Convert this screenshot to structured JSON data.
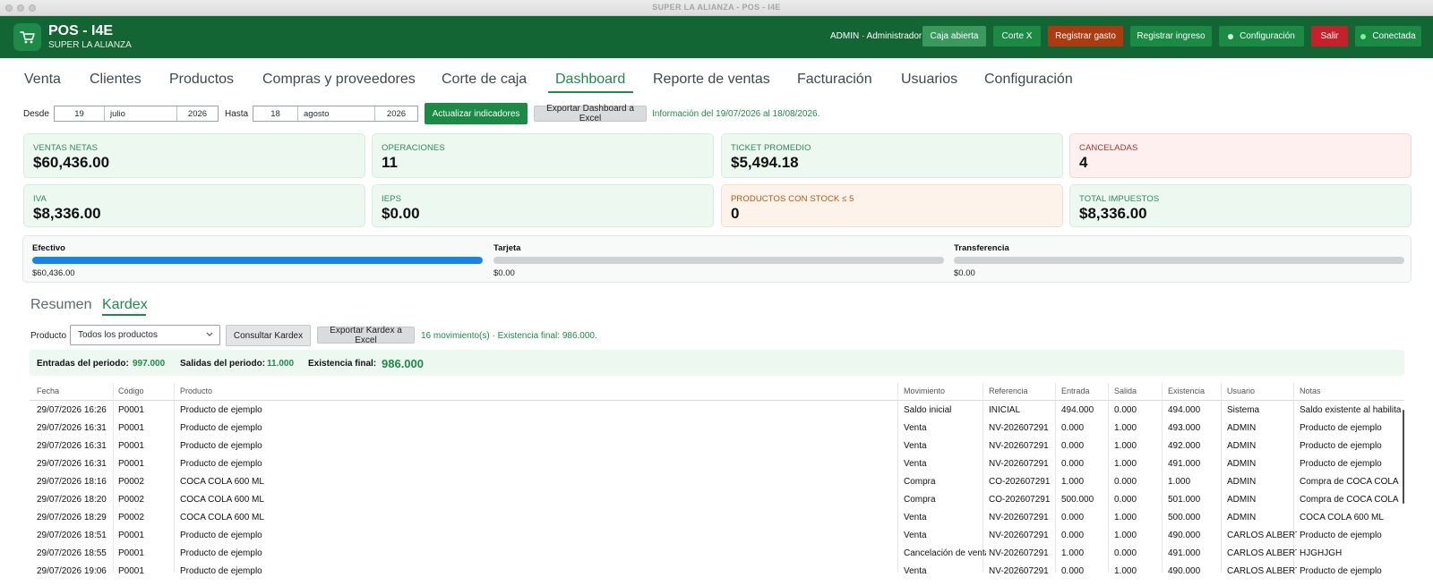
{
  "window": {
    "title": "SUPER LA ALIANZA - POS - I4E"
  },
  "header": {
    "app_name": "POS - I4E",
    "store": "SUPER LA ALIANZA",
    "user": "ADMIN · Administrador",
    "buttons": {
      "caja": "Caja abierta",
      "corte_x": "Corte X",
      "gasto": "Registrar gasto",
      "ingreso": "Registrar ingreso",
      "config": "Configuración",
      "salir": "Salir",
      "status": "Conectada"
    },
    "colors": {
      "bar": "#136634",
      "brown": "#b03a10",
      "red": "#c8202a"
    }
  },
  "tabs": [
    "Venta",
    "Clientes",
    "Productos",
    "Compras y proveedores",
    "Corte de caja",
    "Dashboard",
    "Reporte de ventas",
    "Facturación",
    "Usuarios",
    "Configuración"
  ],
  "active_tab": "Dashboard",
  "filters": {
    "desde_label": "Desde",
    "desde": {
      "day": "19",
      "month": "julio",
      "year": "2026"
    },
    "hasta_label": "Hasta",
    "hasta": {
      "day": "18",
      "month": "agosto",
      "year": "2026"
    },
    "update_button": "Actualizar indicadores",
    "export_button": "Exportar Dashboard a Excel",
    "info": "Información del 19/07/2026 al 18/08/2026."
  },
  "kpis": [
    {
      "label": "VENTAS NETAS",
      "value": "$60,436.00",
      "tone": "green"
    },
    {
      "label": "OPERACIONES",
      "value": "11",
      "tone": "green"
    },
    {
      "label": "TICKET PROMEDIO",
      "value": "$5,494.18",
      "tone": "green"
    },
    {
      "label": "CANCELADAS",
      "value": "4",
      "tone": "red"
    },
    {
      "label": "IVA",
      "value": "$8,336.00",
      "tone": "green"
    },
    {
      "label": "IEPS",
      "value": "$0.00",
      "tone": "green"
    },
    {
      "label": "PRODUCTOS CON STOCK ≤ 5",
      "value": "0",
      "tone": "orange"
    },
    {
      "label": "TOTAL IMPUESTOS",
      "value": "$8,336.00",
      "tone": "green"
    }
  ],
  "payments": [
    {
      "name": "Efectivo",
      "amount": "$60,436.00",
      "fraction": 1.0
    },
    {
      "name": "Tarjeta",
      "amount": "$0.00",
      "fraction": 0
    },
    {
      "name": "Transferencia",
      "amount": "$0.00",
      "fraction": 0
    }
  ],
  "subtabs": {
    "resumen": "Resumen",
    "kardex": "Kardex",
    "active": "Kardex"
  },
  "kardex": {
    "product_label": "Producto",
    "product_value": "Todos los productos",
    "consult_button": "Consultar Kardex",
    "export_button": "Exportar Kardex a Excel",
    "info": "16 movimiento(s) · Existencia final: 986.000.",
    "summary": {
      "entradas_label": "Entradas del periodo:",
      "entradas": "997.000",
      "salidas_label": "Salidas del periodo:",
      "salidas": "11.000",
      "existencia_label": "Existencia final:",
      "existencia": "986.000"
    },
    "columns": [
      "Fecha",
      "Código",
      "Producto",
      "Movimiento",
      "Referencia",
      "Entrada",
      "Salida",
      "Existencia",
      "Usuario",
      "Notas"
    ],
    "rows": [
      [
        "29/07/2026 16:26",
        "P0001",
        "Producto de ejemplo",
        "Saldo inicial",
        "INICIAL",
        "494.000",
        "0.000",
        "494.000",
        "Sistema",
        "Saldo existente al habilita"
      ],
      [
        "29/07/2026 16:31",
        "P0001",
        "Producto de ejemplo",
        "Venta",
        "NV-202607291",
        "0.000",
        "1.000",
        "493.000",
        "ADMIN",
        "Producto de ejemplo"
      ],
      [
        "29/07/2026 16:31",
        "P0001",
        "Producto de ejemplo",
        "Venta",
        "NV-202607291",
        "0.000",
        "1.000",
        "492.000",
        "ADMIN",
        "Producto de ejemplo"
      ],
      [
        "29/07/2026 16:31",
        "P0001",
        "Producto de ejemplo",
        "Venta",
        "NV-202607291",
        "0.000",
        "1.000",
        "491.000",
        "ADMIN",
        "Producto de ejemplo"
      ],
      [
        "29/07/2026 18:16",
        "P0002",
        "COCA COLA 600 ML",
        "Compra",
        "CO-202607291",
        "1.000",
        "0.000",
        "1.000",
        "ADMIN",
        "Compra de COCA COLA"
      ],
      [
        "29/07/2026 18:20",
        "P0002",
        "COCA COLA 600 ML",
        "Compra",
        "CO-202607291",
        "500.000",
        "0.000",
        "501.000",
        "ADMIN",
        "Compra de COCA COLA"
      ],
      [
        "29/07/2026 18:29",
        "P0002",
        "COCA COLA 600 ML",
        "Venta",
        "NV-202607291",
        "0.000",
        "1.000",
        "500.000",
        "ADMIN",
        "COCA COLA 600 ML"
      ],
      [
        "29/07/2026 18:51",
        "P0001",
        "Producto de ejemplo",
        "Venta",
        "NV-202607291",
        "0.000",
        "1.000",
        "490.000",
        "CARLOS ALBERTO",
        "Producto de ejemplo"
      ],
      [
        "29/07/2026 18:55",
        "P0001",
        "Producto de ejemplo",
        "Cancelación de venta",
        "NV-202607291",
        "1.000",
        "0.000",
        "491.000",
        "CARLOS ALBERTO",
        "HJGHJGH"
      ],
      [
        "29/07/2026 19:06",
        "P0001",
        "Producto de ejemplo",
        "Venta",
        "NV-202607291",
        "0.000",
        "1.000",
        "490.000",
        "CARLOS ALBERTO",
        "Producto de ejemplo"
      ]
    ]
  }
}
